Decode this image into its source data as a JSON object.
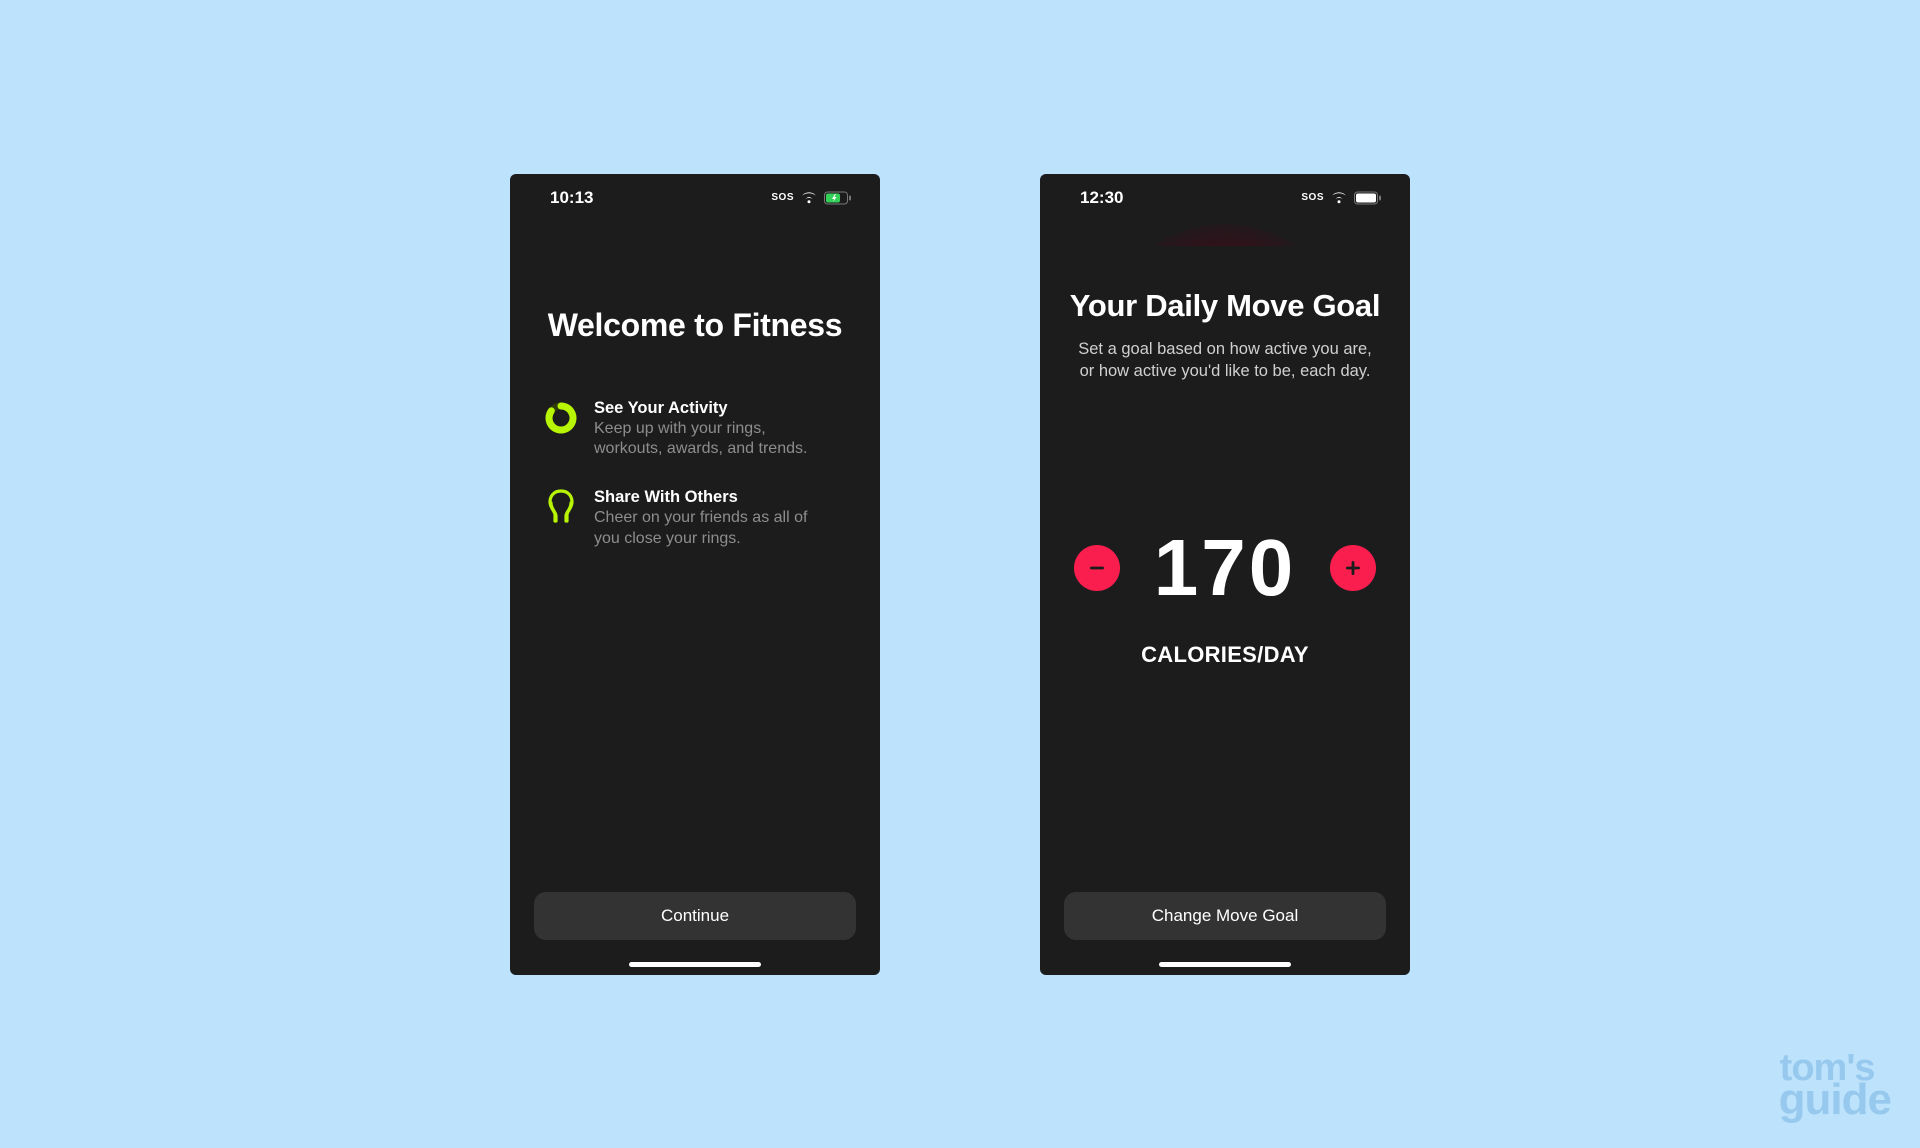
{
  "screen1": {
    "status": {
      "time": "10:13",
      "sos": "SOS"
    },
    "title": "Welcome to Fitness",
    "features": [
      {
        "title": "See Your Activity",
        "desc": "Keep up with your rings, workouts, awards, and trends."
      },
      {
        "title": "Share With Others",
        "desc": "Cheer on your friends as all of you close your rings."
      }
    ],
    "cta": "Continue"
  },
  "screen2": {
    "status": {
      "time": "12:30",
      "sos": "SOS"
    },
    "title": "Your Daily Move Goal",
    "subtitle": "Set a goal based on how active you are, or how active you'd like to be, each day.",
    "value": "170",
    "unit": "CALORIES/DAY",
    "cta": "Change Move Goal"
  },
  "watermark": {
    "line1": "tom's",
    "line2": "guide"
  },
  "colors": {
    "accent_green": "#b7f504",
    "accent_red": "#fa1e4e"
  }
}
